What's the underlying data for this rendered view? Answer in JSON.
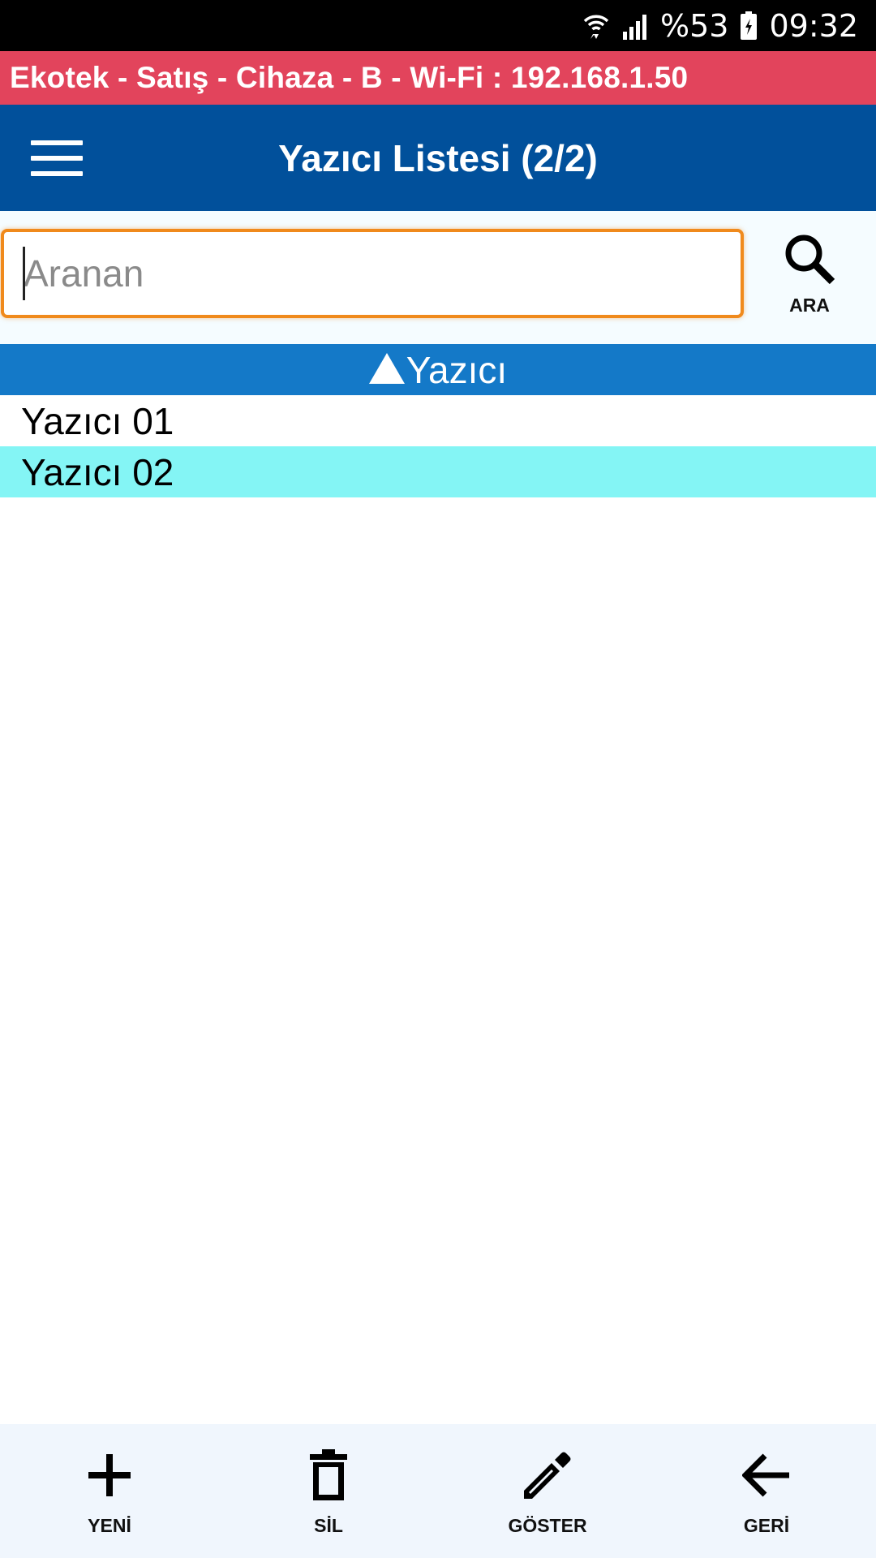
{
  "status_bar": {
    "battery_percent": "%53",
    "time": "09:32",
    "icons": [
      "wifi-icon",
      "signal-icon",
      "battery-icon"
    ]
  },
  "connection_banner": {
    "text": "Ekotek - Satış - Cihaza - B - Wi-Fi : 192.168.1.50",
    "color": "#e2445c"
  },
  "app_bar": {
    "title": "Yazıcı Listesi (2/2)",
    "menu_icon": "hamburger-menu-icon",
    "color": "#01509b"
  },
  "search": {
    "value": "",
    "placeholder": "Aranan",
    "button_label": "ARA",
    "button_icon": "search-icon"
  },
  "list": {
    "column_header": "Yazıcı",
    "sort_icon": "sort-ascending-icon",
    "items": [
      {
        "label": "Yazıcı 01",
        "selected": false
      },
      {
        "label": "Yazıcı 02",
        "selected": true
      }
    ],
    "selected_color": "#84f5f5"
  },
  "toolbar": {
    "new_label": "YENİ",
    "delete_label": "SİL",
    "show_label": "GÖSTER",
    "back_label": "GERİ"
  }
}
